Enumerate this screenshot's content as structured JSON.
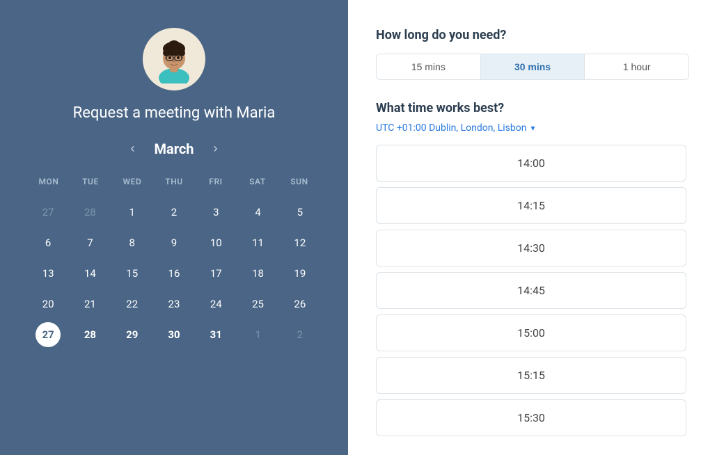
{
  "left": {
    "meeting_title": "Request a meeting with Maria",
    "month": "March",
    "prev_btn": "‹",
    "next_btn": "›",
    "day_headers": [
      "MON",
      "TUE",
      "WED",
      "THU",
      "FRI",
      "SAT",
      "SUN"
    ],
    "weeks": [
      [
        {
          "num": "27",
          "type": "other-month"
        },
        {
          "num": "28",
          "type": "other-month"
        },
        {
          "num": "1",
          "type": "current-month"
        },
        {
          "num": "2",
          "type": "current-month"
        },
        {
          "num": "3",
          "type": "current-month"
        },
        {
          "num": "4",
          "type": "current-month"
        },
        {
          "num": "5",
          "type": "current-month"
        }
      ],
      [
        {
          "num": "6",
          "type": "current-month"
        },
        {
          "num": "7",
          "type": "current-month"
        },
        {
          "num": "8",
          "type": "current-month"
        },
        {
          "num": "9",
          "type": "current-month"
        },
        {
          "num": "10",
          "type": "current-month"
        },
        {
          "num": "11",
          "type": "current-month"
        },
        {
          "num": "12",
          "type": "current-month"
        }
      ],
      [
        {
          "num": "13",
          "type": "current-month"
        },
        {
          "num": "14",
          "type": "current-month"
        },
        {
          "num": "15",
          "type": "current-month"
        },
        {
          "num": "16",
          "type": "current-month"
        },
        {
          "num": "17",
          "type": "current-month"
        },
        {
          "num": "18",
          "type": "current-month"
        },
        {
          "num": "19",
          "type": "current-month"
        }
      ],
      [
        {
          "num": "20",
          "type": "current-month"
        },
        {
          "num": "21",
          "type": "current-month"
        },
        {
          "num": "22",
          "type": "current-month"
        },
        {
          "num": "23",
          "type": "current-month"
        },
        {
          "num": "24",
          "type": "current-month"
        },
        {
          "num": "25",
          "type": "current-month"
        },
        {
          "num": "26",
          "type": "current-month"
        }
      ],
      [
        {
          "num": "27",
          "type": "current-month selected bold"
        },
        {
          "num": "28",
          "type": "current-month bold"
        },
        {
          "num": "29",
          "type": "current-month bold"
        },
        {
          "num": "30",
          "type": "current-month bold"
        },
        {
          "num": "31",
          "type": "current-month bold"
        },
        {
          "num": "1",
          "type": "other-month"
        },
        {
          "num": "2",
          "type": "other-month"
        }
      ]
    ]
  },
  "right": {
    "duration_title": "How long do you need?",
    "duration_buttons": [
      {
        "label": "15 mins",
        "active": false
      },
      {
        "label": "30 mins",
        "active": true
      },
      {
        "label": "1 hour",
        "active": false
      }
    ],
    "time_title": "What time works best?",
    "timezone": "UTC +01:00 Dublin, London, Lisbon",
    "time_slots": [
      "14:00",
      "14:15",
      "14:30",
      "14:45",
      "15:00",
      "15:15",
      "15:30"
    ]
  }
}
